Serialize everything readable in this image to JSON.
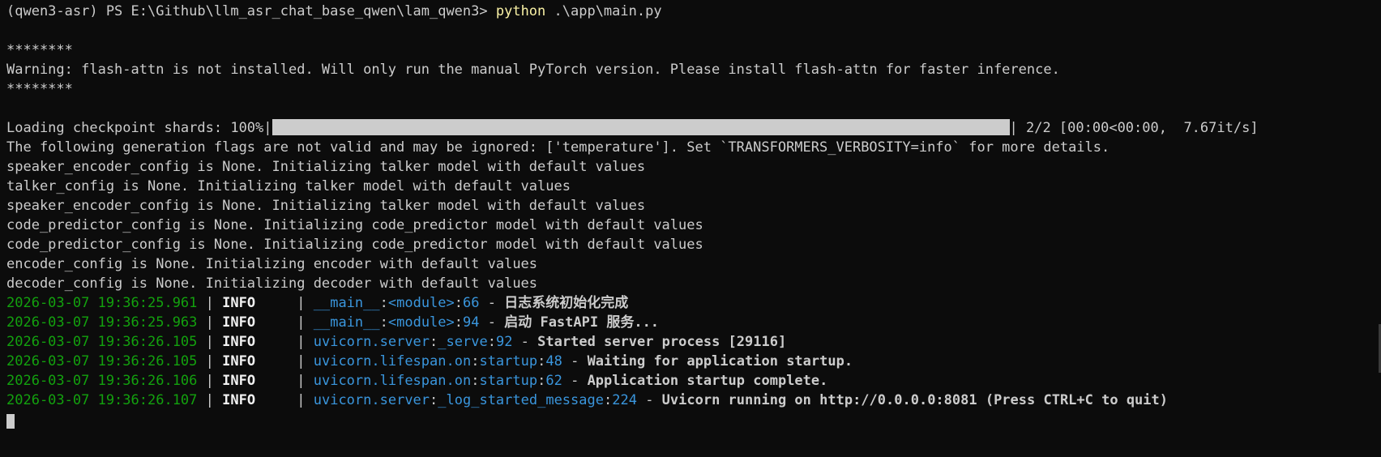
{
  "prompt": {
    "prefix": "(qwen3-asr) PS E:\\Github\\llm_asr_chat_base_qwen\\lam_qwen3> ",
    "command": "python",
    "args": " .\\app\\main.py"
  },
  "banner": {
    "stars_top": "********",
    "warning": "Warning: flash-attn is not installed. Will only run the manual PyTorch version. Please install flash-attn for faster inference.",
    "stars_bottom": "********"
  },
  "progress": {
    "label": "Loading checkpoint shards: 100%|",
    "fraction": 1.0,
    "suffix": "| 2/2 [00:00<00:00,  7.67it/s]"
  },
  "plain_lines": [
    "The following generation flags are not valid and may be ignored: ['temperature']. Set `TRANSFORMERS_VERBOSITY=info` for more details.",
    "speaker_encoder_config is None. Initializing talker model with default values",
    "talker_config is None. Initializing talker model with default values",
    "speaker_encoder_config is None. Initializing talker model with default values",
    "code_predictor_config is None. Initializing code_predictor model with default values",
    "code_predictor_config is None. Initializing code_predictor model with default values",
    "encoder_config is None. Initializing encoder with default values",
    "decoder_config is None. Initializing decoder with default values"
  ],
  "log_lines": [
    {
      "ts": "2026-03-07 19:36:25.961",
      "level": "INFO",
      "mod": "__main__",
      "func": "<module>",
      "line": "66",
      "msg": "日志系统初始化完成"
    },
    {
      "ts": "2026-03-07 19:36:25.963",
      "level": "INFO",
      "mod": "__main__",
      "func": "<module>",
      "line": "94",
      "msg": "启动 FastAPI 服务..."
    },
    {
      "ts": "2026-03-07 19:36:26.105",
      "level": "INFO",
      "mod": "uvicorn.server",
      "func": "_serve",
      "line": "92",
      "msg": "Started server process [29116]"
    },
    {
      "ts": "2026-03-07 19:36:26.105",
      "level": "INFO",
      "mod": "uvicorn.lifespan.on",
      "func": "startup",
      "line": "48",
      "msg": "Waiting for application startup."
    },
    {
      "ts": "2026-03-07 19:36:26.106",
      "level": "INFO",
      "mod": "uvicorn.lifespan.on",
      "func": "startup",
      "line": "62",
      "msg": "Application startup complete."
    },
    {
      "ts": "2026-03-07 19:36:26.107",
      "level": "INFO",
      "mod": "uvicorn.server",
      "func": "_log_started_message",
      "line": "224",
      "msg": "Uvicorn running on http://0.0.0.0:8081 (Press CTRL+C to quit)"
    }
  ],
  "colors": {
    "background": "#0c0c0c",
    "text": "#cccccc",
    "command": "#f9f1a5",
    "timestamp": "#13a10e",
    "module": "#3a96dd"
  }
}
